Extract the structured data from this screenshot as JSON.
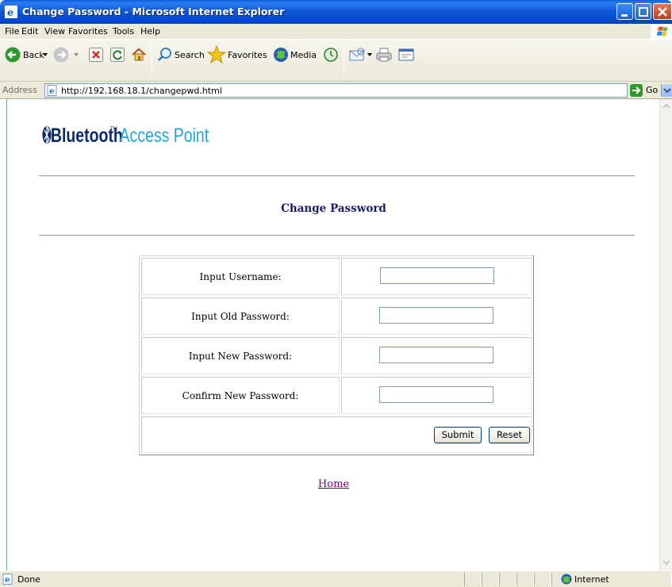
{
  "window": {
    "title": "Change Password - Microsoft Internet Explorer"
  },
  "menu": [
    "File",
    "Edit",
    "View",
    "Favorites",
    "Tools",
    "Help"
  ],
  "toolbar": {
    "back": "Back",
    "search": "Search",
    "favorites": "Favorites",
    "media": "Media"
  },
  "address": {
    "label": "Address",
    "url": "http://192.168.18.1/changepwd.html",
    "go": "Go"
  },
  "page": {
    "logo_text": "Bluetooth",
    "logo_tm": "TM",
    "logo_sub": "Access Point",
    "title": "Change Password",
    "fields": [
      {
        "label": "Input Username:",
        "value": ""
      },
      {
        "label": "Input Old Password:",
        "value": ""
      },
      {
        "label": "Input New Password:",
        "value": ""
      },
      {
        "label": "Confirm New Password:",
        "value": ""
      }
    ],
    "submit": "Submit",
    "reset": "Reset",
    "home_link": "Home"
  },
  "status": {
    "text": "Done",
    "zone": "Internet"
  },
  "colors": {
    "title_text": "#1a1a6e",
    "link_visited": "#800080",
    "logo_dark": "#0b2a6b",
    "logo_light": "#1fa8e0"
  }
}
